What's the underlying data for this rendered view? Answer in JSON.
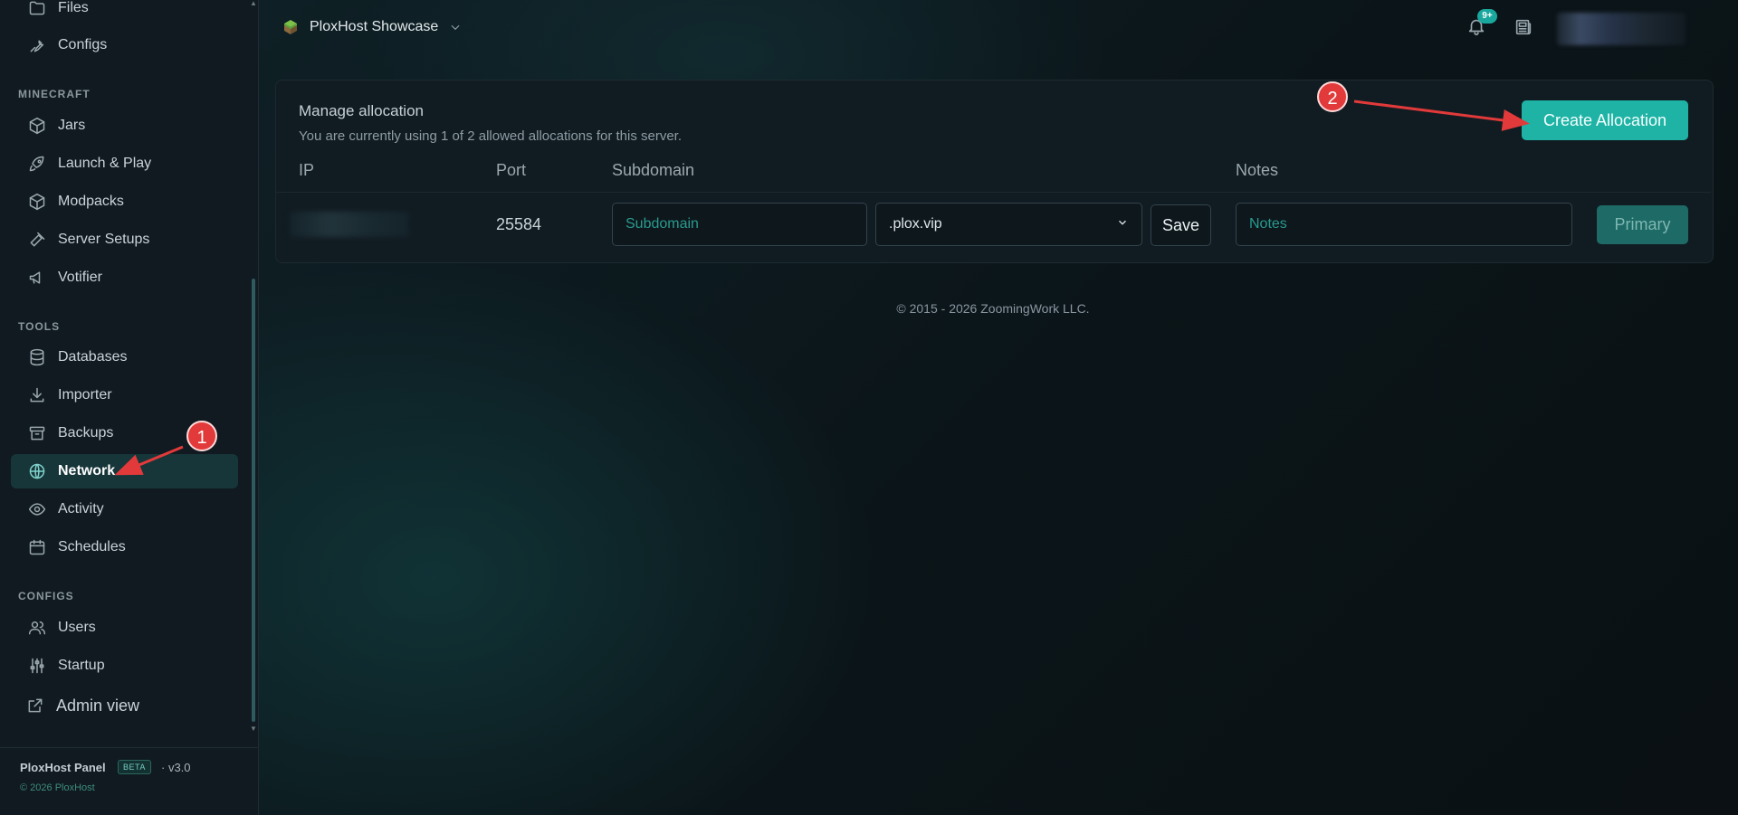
{
  "sidebar": {
    "items_top": [
      {
        "label": "Files",
        "icon": "folder-icon"
      },
      {
        "label": "Configs",
        "icon": "wrench-icon"
      }
    ],
    "minecraft": {
      "title": "MINECRAFT",
      "items": [
        {
          "label": "Jars",
          "icon": "cube-icon"
        },
        {
          "label": "Launch & Play",
          "icon": "rocket-icon"
        },
        {
          "label": "Modpacks",
          "icon": "cube-icon"
        },
        {
          "label": "Server Setups",
          "icon": "hammer-icon"
        },
        {
          "label": "Votifier",
          "icon": "megaphone-icon"
        }
      ]
    },
    "tools": {
      "title": "TOOLS",
      "items": [
        {
          "label": "Databases",
          "icon": "database-icon"
        },
        {
          "label": "Importer",
          "icon": "download-icon"
        },
        {
          "label": "Backups",
          "icon": "archive-icon"
        },
        {
          "label": "Network",
          "icon": "globe-icon",
          "active": true
        },
        {
          "label": "Activity",
          "icon": "eye-icon"
        },
        {
          "label": "Schedules",
          "icon": "calendar-icon"
        }
      ]
    },
    "configs": {
      "title": "CONFIGS",
      "items": [
        {
          "label": "Users",
          "icon": "users-icon"
        },
        {
          "label": "Startup",
          "icon": "sliders-icon"
        }
      ]
    },
    "admin_view": "Admin view",
    "footer": {
      "panel_name": "PloxHost Panel",
      "badge": "BETA",
      "version": "· v3.0",
      "copyright": "© 2026 PloxHost"
    }
  },
  "topbar": {
    "server_name": "PloxHost Showcase",
    "notification_count": "9+"
  },
  "allocation": {
    "title": "Manage allocation",
    "subtitle": "You are currently using 1 of 2 allowed allocations for this server.",
    "create_button": "Create Allocation",
    "columns": {
      "ip": "IP",
      "port": "Port",
      "subdomain": "Subdomain",
      "notes": "Notes"
    },
    "row": {
      "port": "25584",
      "subdomain_placeholder": "Subdomain",
      "domain_selected": ".plox.vip",
      "save_label": "Save",
      "notes_placeholder": "Notes",
      "primary_label": "Primary"
    }
  },
  "footer": {
    "copyright": "© 2015 - 2026 ZoomingWork LLC."
  },
  "annotations": {
    "marker_1": "1",
    "marker_2": "2"
  },
  "colors": {
    "accent": "#1fb3a6",
    "active_bg": "#17363a",
    "marker": "#e23a3a"
  }
}
